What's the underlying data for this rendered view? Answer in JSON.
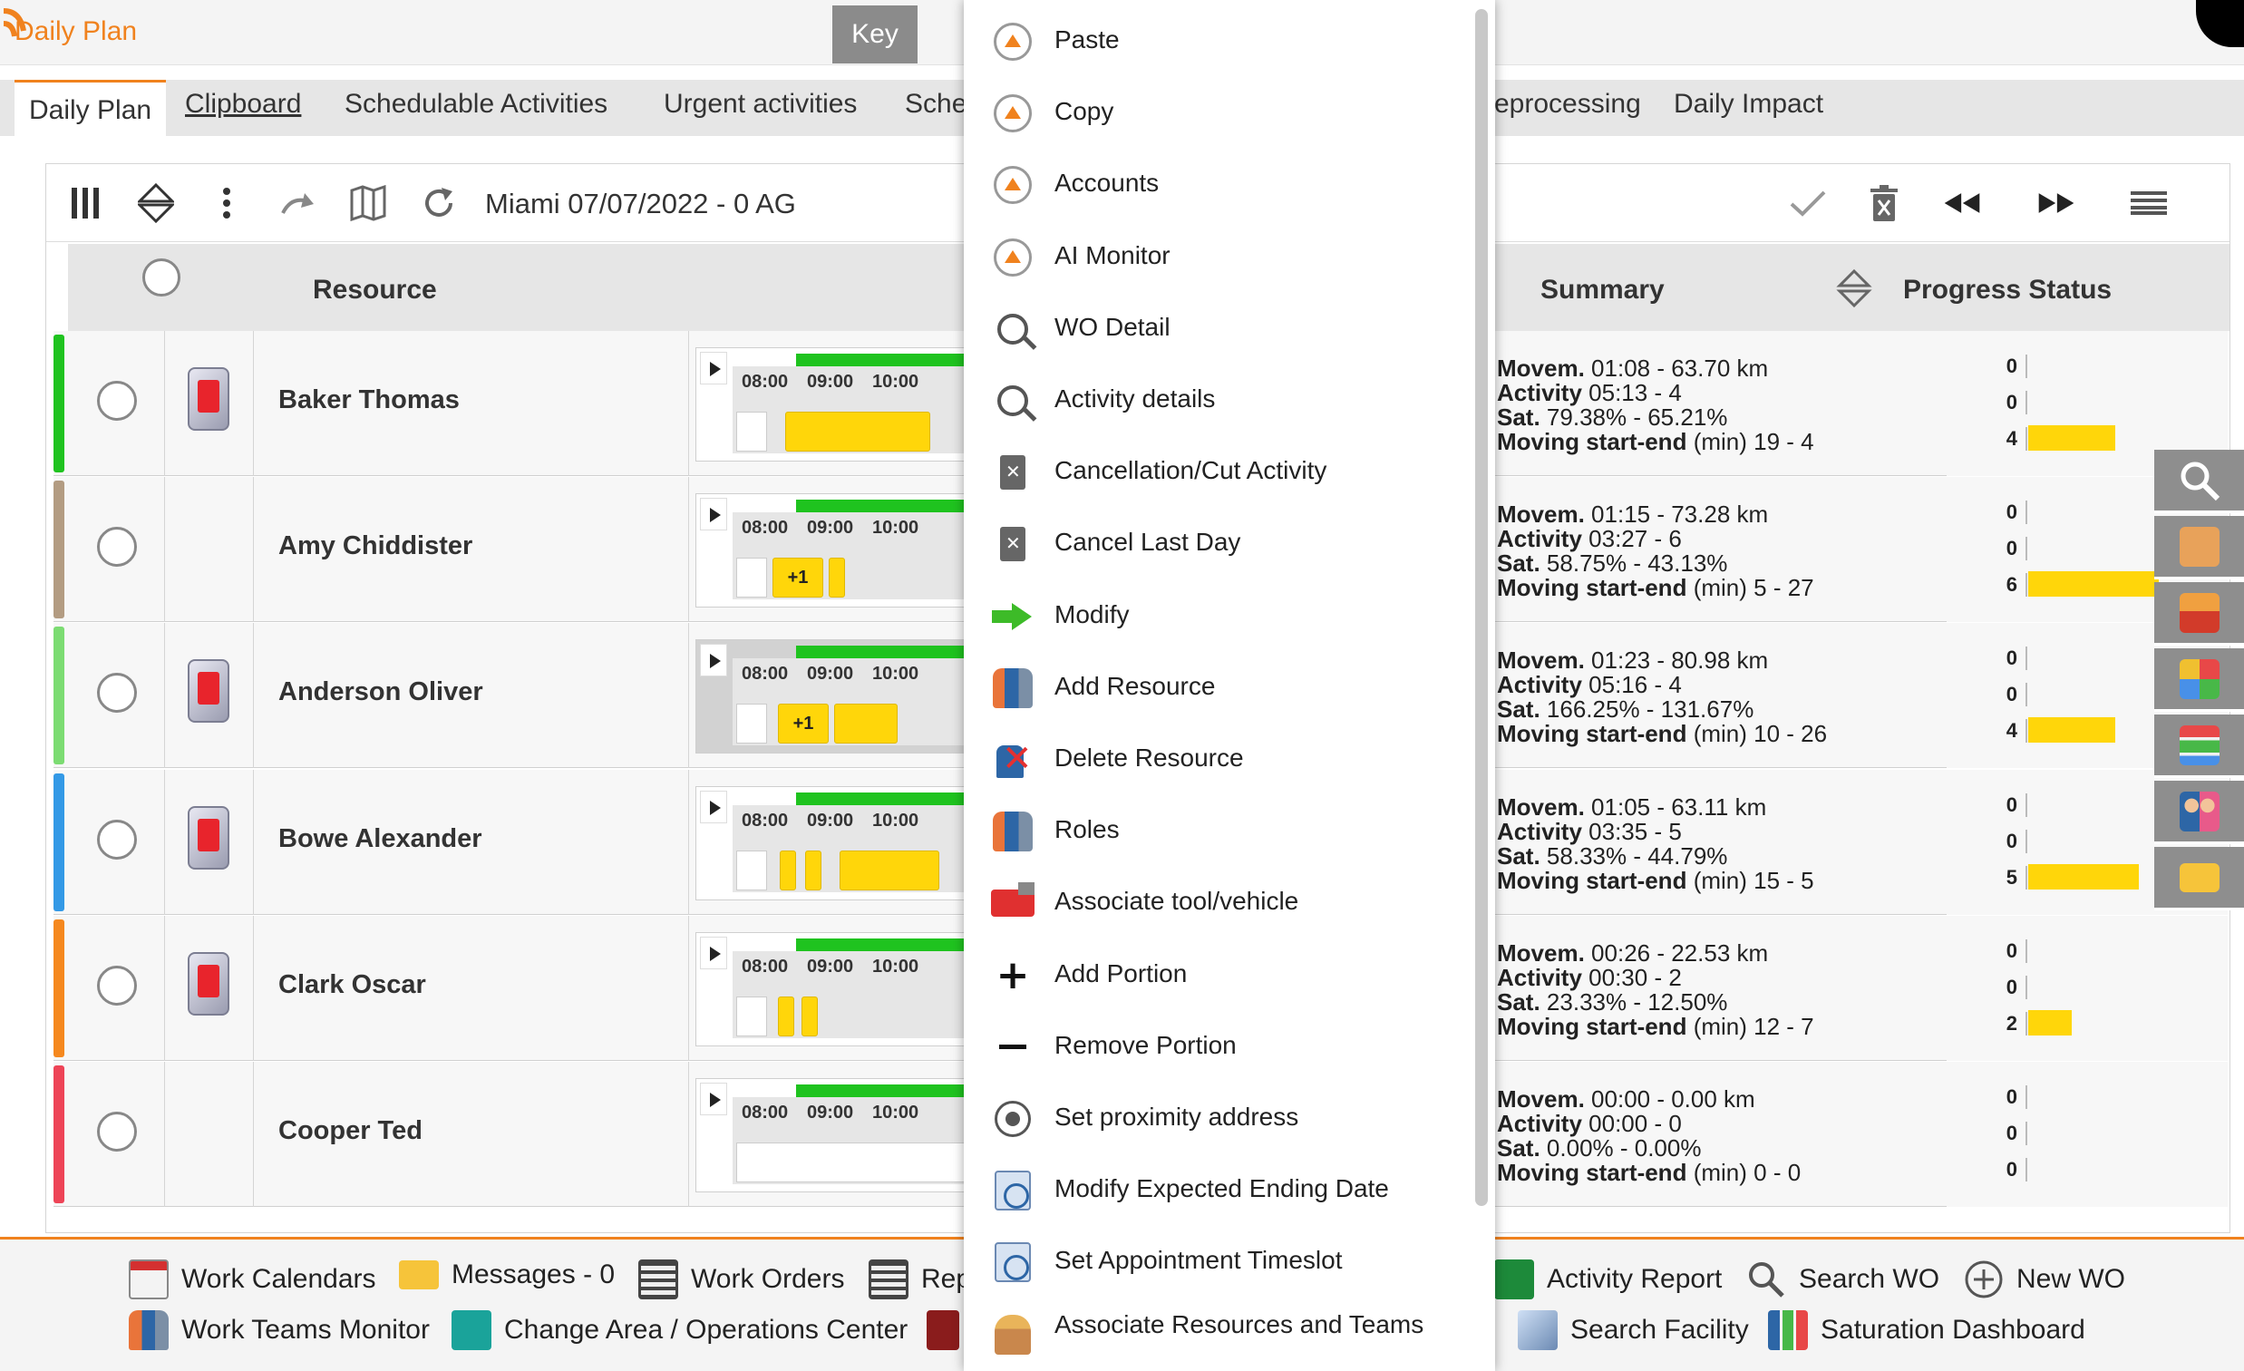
{
  "header": {
    "app_title": "Daily Plan",
    "key_button": "Key"
  },
  "tabs": [
    {
      "label": "Daily Plan"
    },
    {
      "label": "Clipboard"
    },
    {
      "label": "Schedulable Activities"
    },
    {
      "label": "Urgent activities"
    },
    {
      "label": "Sche"
    },
    {
      "label": "eprocessing"
    },
    {
      "label": "Daily Impact"
    }
  ],
  "toolbar": {
    "title": "Miami 07/07/2022 - 0 AG"
  },
  "table": {
    "col_resource": "Resource",
    "col_summary": "Summary",
    "col_progress": "Progress Status",
    "ticks": [
      "08:00",
      "09:00",
      "10:00"
    ],
    "summary_labels": {
      "movem": "Movem.",
      "activity": "Activity",
      "sat": "Sat.",
      "moving": "Moving start-end",
      "min": "(min)"
    },
    "rows": [
      {
        "name": "Baker Thomas",
        "stripe": "#1fc31f",
        "device": true,
        "badge": "",
        "movem": "01:08 - 63.70 km",
        "activity": "05:13 - 4",
        "sat": "79.38% - 65.21%",
        "moving": "19 - 4",
        "p1": "0",
        "p2": "0",
        "p3": "4",
        "p3_fraction": 0.3
      },
      {
        "name": "Amy Chiddister",
        "stripe": "#b39c82",
        "device": false,
        "badge": "+1",
        "movem": "01:15 - 73.28 km",
        "activity": "03:27 - 6",
        "sat": "58.75% - 43.13%",
        "moving": "5 - 27",
        "p1": "0",
        "p2": "0",
        "p3": "6",
        "p3_fraction": 0.45
      },
      {
        "name": "Anderson Oliver",
        "stripe": "#7cdc72",
        "device": true,
        "badge": "+1",
        "movem": "01:23 - 80.98 km",
        "activity": "05:16 - 4",
        "sat": "166.25% - 131.67%",
        "moving": "10 - 26",
        "p1": "0",
        "p2": "0",
        "p3": "4",
        "p3_fraction": 0.3
      },
      {
        "name": "Bowe Alexander",
        "stripe": "#3399e6",
        "device": true,
        "badge": "",
        "movem": "01:05 - 63.11 km",
        "activity": "03:35 - 5",
        "sat": "58.33% - 44.79%",
        "moving": "15 - 5",
        "p1": "0",
        "p2": "0",
        "p3": "5",
        "p3_fraction": 0.38
      },
      {
        "name": "Clark Oscar",
        "stripe": "#f5881e",
        "device": true,
        "badge": "",
        "movem": "00:26 - 22.53 km",
        "activity": "00:30 - 2",
        "sat": "23.33% - 12.50%",
        "moving": "12 - 7",
        "p1": "0",
        "p2": "0",
        "p3": "2",
        "p3_fraction": 0.15
      },
      {
        "name": "Cooper Ted",
        "stripe": "#ee4457",
        "device": false,
        "badge": "",
        "movem": "00:00 - 0.00 km",
        "activity": "00:00 - 0",
        "sat": "0.00% - 0.00%",
        "moving": "0 - 0",
        "p1": "0",
        "p2": "0",
        "p3": "0",
        "p3_fraction": 0
      }
    ]
  },
  "context_menu": {
    "items": [
      {
        "label": "Paste",
        "icon": "orange-up-circle-icon"
      },
      {
        "label": "Copy",
        "icon": "orange-up-circle-icon"
      },
      {
        "label": "Accounts",
        "icon": "orange-up-circle-icon"
      },
      {
        "label": "AI Monitor",
        "icon": "orange-up-circle-icon"
      },
      {
        "label": "WO Detail",
        "icon": "search-icon"
      },
      {
        "label": "Activity details",
        "icon": "search-icon"
      },
      {
        "label": "Cancellation/Cut Activity",
        "icon": "trash-icon"
      },
      {
        "label": "Cancel Last Day",
        "icon": "trash-icon"
      },
      {
        "label": "Modify",
        "icon": "green-arrow-icon"
      },
      {
        "label": "Add Resource",
        "icon": "people-icon"
      },
      {
        "label": "Delete Resource",
        "icon": "delete-person-icon"
      },
      {
        "label": "Roles",
        "icon": "people-icon"
      },
      {
        "label": "Associate tool/vehicle",
        "icon": "truck-icon"
      },
      {
        "label": "Add Portion",
        "icon": "plus-icon"
      },
      {
        "label": "Remove Portion",
        "icon": "minus-icon"
      },
      {
        "label": "Set proximity address",
        "icon": "target-icon"
      },
      {
        "label": "Modify Expected Ending Date",
        "icon": "clock-icon"
      },
      {
        "label": "Set Appointment Timeslot",
        "icon": "clock-icon"
      },
      {
        "label": "Associate Resources and Teams",
        "icon": "worker-icon"
      }
    ]
  },
  "bottom_bar": {
    "work_calendars": "Work Calendars",
    "messages": "Messages - 0",
    "work_orders": "Work Orders",
    "rep": "Rep",
    "work_teams_monitor": "Work Teams Monitor",
    "change_area": "Change Area / Operations Center",
    "activity_report": "Activity Report",
    "search_wo": "Search WO",
    "new_wo": "New WO",
    "search_facility": "Search Facility",
    "saturation_dashboard": "Saturation Dashboard"
  },
  "colors": {
    "accent": "#f0821e",
    "progress_bar": "#ffd60a",
    "gantt_bar": "#1fc31f"
  }
}
